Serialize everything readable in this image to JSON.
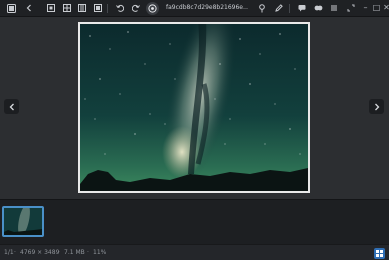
{
  "toolbar": {
    "filename": "fa9cdb8c7d29e8b21696e…",
    "window_controls": {
      "restore": "–",
      "minimize": "□",
      "maximize": "✕",
      "close": "✕"
    }
  },
  "viewer": {
    "image_description_icon": "photo"
  },
  "statusbar": {
    "index": "1/1",
    "dimensions": "4769 × 3489",
    "filesize": "7.1 MB",
    "zoom": "11%"
  },
  "colors": {
    "accent": "#2f6eb4",
    "toolbar_bg": "#1f2124",
    "viewer_bg": "#2c2e31"
  }
}
